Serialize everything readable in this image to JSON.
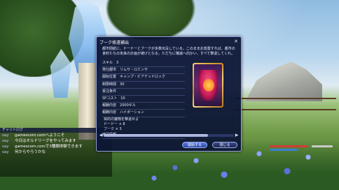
{
  "chat": {
    "header": "チャットログ",
    "lines": [
      {
        "who": "say",
        "text": "gamescom.comへようこそ"
      },
      {
        "who": "say",
        "text": "今日はオルドリーグをやってみます"
      },
      {
        "who": "say",
        "text": "gamescom.comで3種類体験できます"
      },
      {
        "who": "say",
        "text": "何からやろうかな"
      }
    ]
  },
  "dialog": {
    "title": "ブーク修遠補出",
    "close": "×",
    "description": "都市間航に、ドードーとブークが多数出没している。このままお放置すれば、都市の食料たちの未来の計画が被げとなる。ただちに殲滅へ向かい、すべて撃退してくれ。",
    "info": [
      {
        "label": "スキル",
        "value": "3"
      },
      {
        "label": "発仕都市",
        "value": "リムサ・ロミンサ"
      },
      {
        "label": "開始位置",
        "value": "キャンプ・ビアテッドロック"
      },
      {
        "label": "制限時間",
        "value": "30"
      },
      {
        "label": "受注条件",
        "value": ""
      },
      {
        "label": "SPコスト",
        "value": "10"
      },
      {
        "label": "報酬内容",
        "value": "2000ギル"
      },
      {
        "label": "報酬内容",
        "value": "ハイポーション"
      }
    ],
    "targets_header": "目的の魔物を撃退せよ",
    "targets": [
      {
        "name": "ドードー",
        "count": "× 8"
      },
      {
        "name": "ブーク",
        "count": "× 3"
      }
    ],
    "notes_label": "補足情報",
    "notes_value": "—",
    "start_label": "開始する",
    "close_label": "閉じる",
    "scroll_fraction": 0.8
  }
}
